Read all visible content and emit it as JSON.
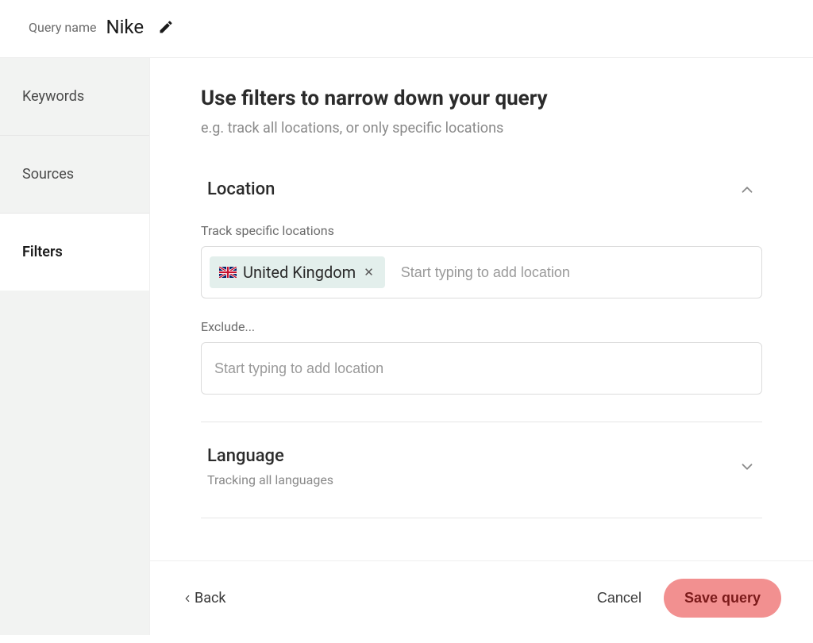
{
  "header": {
    "query_name_label": "Query name",
    "query_name_value": "Nike"
  },
  "sidebar": {
    "items": [
      {
        "id": "keywords",
        "label": "Keywords",
        "active": false
      },
      {
        "id": "sources",
        "label": "Sources",
        "active": false
      },
      {
        "id": "filters",
        "label": "Filters",
        "active": true
      }
    ]
  },
  "main": {
    "title": "Use filters to narrow down your query",
    "subtitle": "e.g. track all locations, or only specific locations"
  },
  "location": {
    "title": "Location",
    "expanded": true,
    "track_label": "Track specific locations",
    "include_placeholder": "Start typing to add location",
    "chips": [
      {
        "flag": "uk",
        "label": "United Kingdom"
      }
    ],
    "exclude_label": "Exclude...",
    "exclude_placeholder": "Start typing to add location"
  },
  "language": {
    "title": "Language",
    "expanded": false,
    "subtitle": "Tracking all languages"
  },
  "footer": {
    "back_label": "Back",
    "cancel_label": "Cancel",
    "save_label": "Save query"
  }
}
